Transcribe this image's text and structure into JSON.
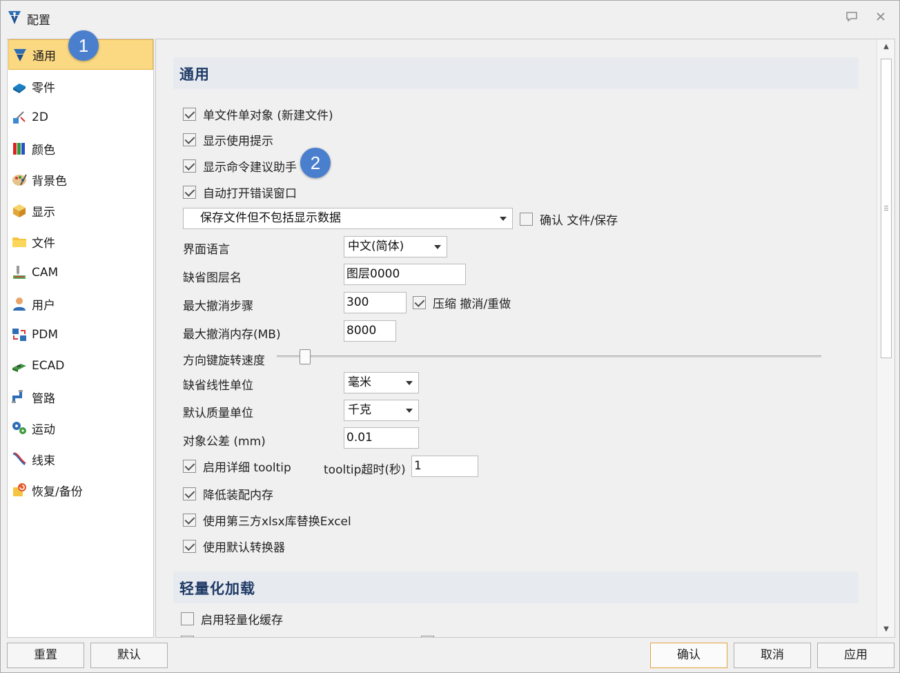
{
  "window": {
    "title": "配置"
  },
  "sidebar": {
    "items": [
      {
        "label": "通用",
        "icon": "general-icon",
        "active": true
      },
      {
        "label": "零件",
        "icon": "part-icon"
      },
      {
        "label": "2D",
        "icon": "drawing-2d-icon"
      },
      {
        "label": "颜色",
        "icon": "color-icon"
      },
      {
        "label": "背景色",
        "icon": "background-color-icon"
      },
      {
        "label": "显示",
        "icon": "display-icon"
      },
      {
        "label": "文件",
        "icon": "folder-icon"
      },
      {
        "label": "CAM",
        "icon": "cam-icon"
      },
      {
        "label": "用户",
        "icon": "user-icon"
      },
      {
        "label": "PDM",
        "icon": "pdm-icon"
      },
      {
        "label": "ECAD",
        "icon": "ecad-icon"
      },
      {
        "label": "管路",
        "icon": "piping-icon"
      },
      {
        "label": "运动",
        "icon": "motion-icon"
      },
      {
        "label": "线束",
        "icon": "wire-harness-icon"
      },
      {
        "label": "恢复/备份",
        "icon": "restore-backup-icon"
      }
    ]
  },
  "annotations": {
    "badge1": "1",
    "badge2": "2"
  },
  "general": {
    "title": "通用",
    "single_doc": {
      "label": "单文件单对象 (新建文件)",
      "checked": true
    },
    "show_tips": {
      "label": "显示使用提示",
      "checked": true
    },
    "show_cmd_assistant": {
      "label": "显示命令建议助手",
      "checked": true
    },
    "auto_error_window": {
      "label": "自动打开错误窗口",
      "checked": true
    },
    "save_mode": {
      "value": "保存文件但不包括显示数据"
    },
    "confirm_save": {
      "label": "确认 文件/保存",
      "checked": false
    },
    "ui_language": {
      "label": "界面语言",
      "value": "中文(简体)"
    },
    "default_layer": {
      "label": "缺省图层名",
      "value": "图层0000"
    },
    "max_undo_steps": {
      "label": "最大撤消步骤",
      "value": "300"
    },
    "compress_undo": {
      "label": "压缩 撤消/重做",
      "checked": true
    },
    "max_undo_memory": {
      "label": "最大撤消内存(MB)",
      "value": "8000"
    },
    "arrow_rotate_speed": {
      "label": "方向键旋转速度",
      "level": 0.05
    },
    "default_linear_unit": {
      "label": "缺省线性单位",
      "value": "毫米"
    },
    "default_mass_unit": {
      "label": "默认质量单位",
      "value": "千克"
    },
    "object_tolerance": {
      "label": "对象公差  (mm)",
      "value": "0.01"
    },
    "detailed_tooltip": {
      "label": "启用详细 tooltip",
      "checked": true
    },
    "tooltip_timeout": {
      "label": "tooltip超时(秒)",
      "value": "1"
    },
    "reduce_assembly_memory": {
      "label": "降低装配内存",
      "checked": true
    },
    "use_xlsx_lib": {
      "label": "使用第三方xlsx库替换Excel",
      "checked": true
    },
    "use_default_converter": {
      "label": "使用默认转换器",
      "checked": true
    }
  },
  "lightweight": {
    "title": "轻量化加载",
    "enable_cache": {
      "label": "启用轻量化缓存",
      "checked": false
    }
  },
  "buttons": {
    "reset": "重置",
    "default": "默认",
    "ok": "确认",
    "cancel": "取消",
    "apply": "应用"
  }
}
